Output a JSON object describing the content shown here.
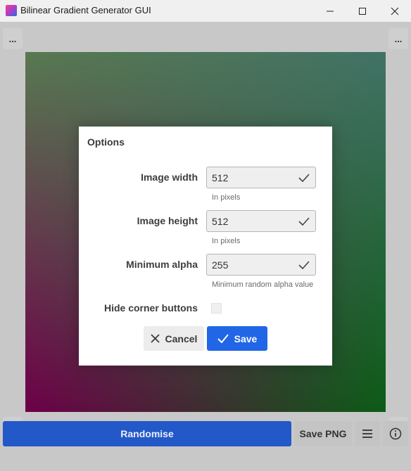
{
  "window": {
    "title": "Bilinear Gradient Generator GUI"
  },
  "gradient": {
    "top_left": "#7aa870",
    "top_right": "#5c9e8e",
    "bottom_left": "#990066",
    "bottom_right": "#128020"
  },
  "corner_buttons": {
    "label": "..."
  },
  "dialog": {
    "title": "Options",
    "fields": [
      {
        "label": "Image width",
        "value": "512",
        "hint": "In pixels"
      },
      {
        "label": "Image height",
        "value": "512",
        "hint": "In pixels"
      },
      {
        "label": "Minimum alpha",
        "value": "255",
        "hint": "Minimum random alpha value"
      }
    ],
    "checkbox": {
      "label": "Hide corner buttons",
      "checked": false
    },
    "cancel_label": "Cancel",
    "save_label": "Save"
  },
  "toolbar": {
    "randomise_label": "Randomise",
    "save_png_label": "Save PNG"
  },
  "colors": {
    "accent": "#2166e6",
    "randomise": "#2358c9"
  }
}
